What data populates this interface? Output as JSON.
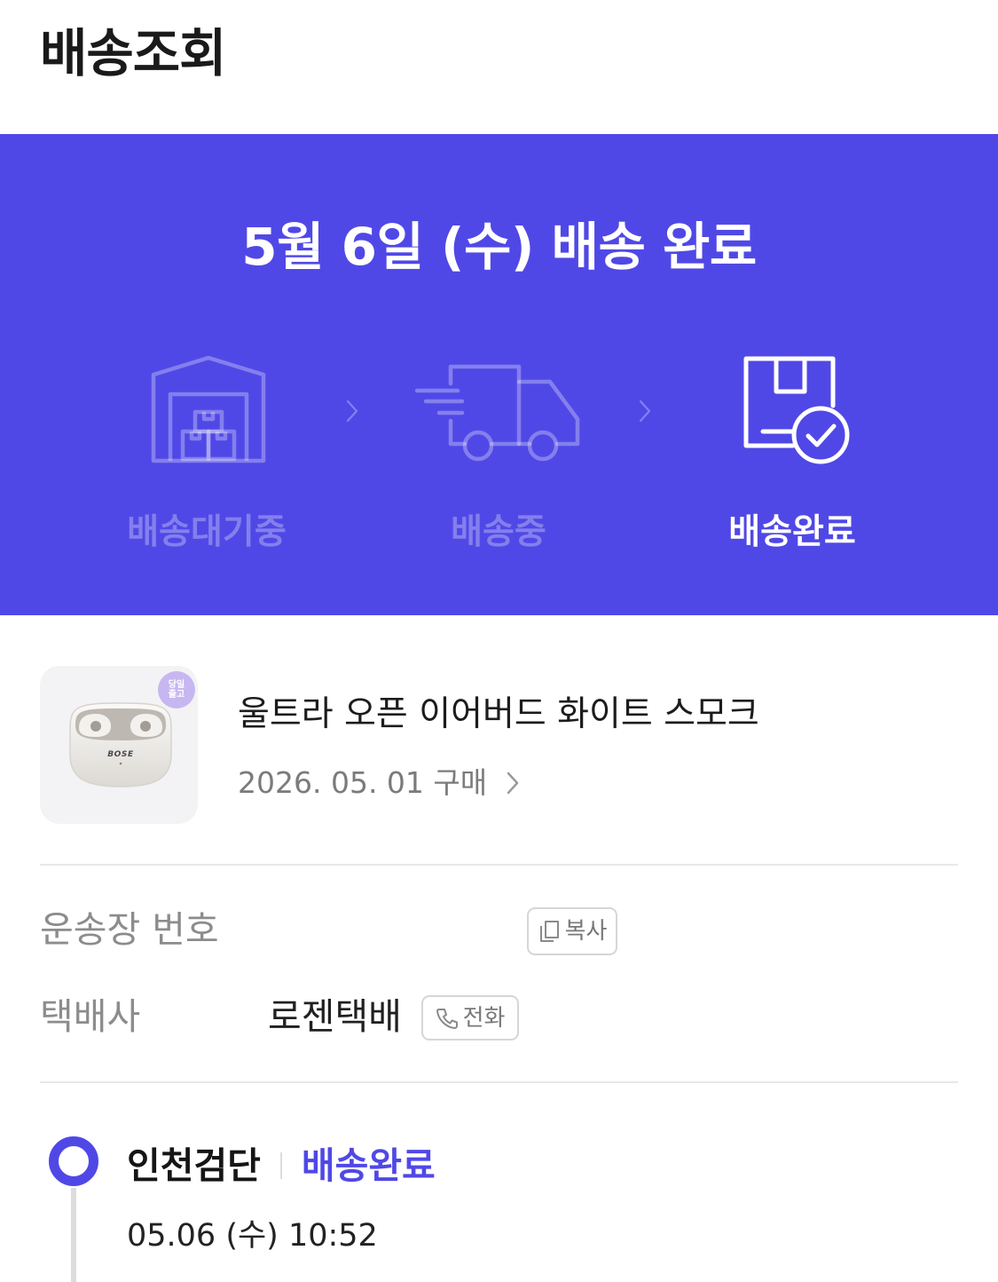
{
  "page": {
    "title": "배송조회"
  },
  "colors": {
    "accent": "#5048E6",
    "text_dark": "#1C1C1C",
    "label_gray": "#8C8C8C",
    "divider": "#E8E8E8",
    "badge": "#C7B7F0"
  },
  "banner": {
    "title": "5월 6일 (수) 배송 완료",
    "separator_icon": "chevron-right-icon",
    "steps": [
      {
        "label": "배송대기중",
        "icon": "warehouse-icon",
        "active": false
      },
      {
        "label": "배송중",
        "icon": "truck-icon",
        "active": false
      },
      {
        "label": "배송완료",
        "icon": "box-check-icon",
        "active": true
      }
    ]
  },
  "product": {
    "name": "울트라 오픈 이어버드 화이트 스모크",
    "purchase_date": "2026. 05. 01 구매",
    "badge_lines": [
      "당일",
      "출고"
    ],
    "image_logo_text": "BOSE",
    "image": "earbuds-case-image",
    "link_icon": "chevron-right-icon"
  },
  "shipment": {
    "tracking_label": "운송장 번호",
    "copy_button": {
      "label": "복사",
      "icon": "copy-icon"
    },
    "carrier_label": "택배사",
    "carrier_name": "로젠택배",
    "call_button": {
      "label": "전화",
      "icon": "phone-icon"
    }
  },
  "timeline": [
    {
      "location": "인천검단",
      "status": "배송완료",
      "time": "05.06 (수) 10:52"
    }
  ]
}
